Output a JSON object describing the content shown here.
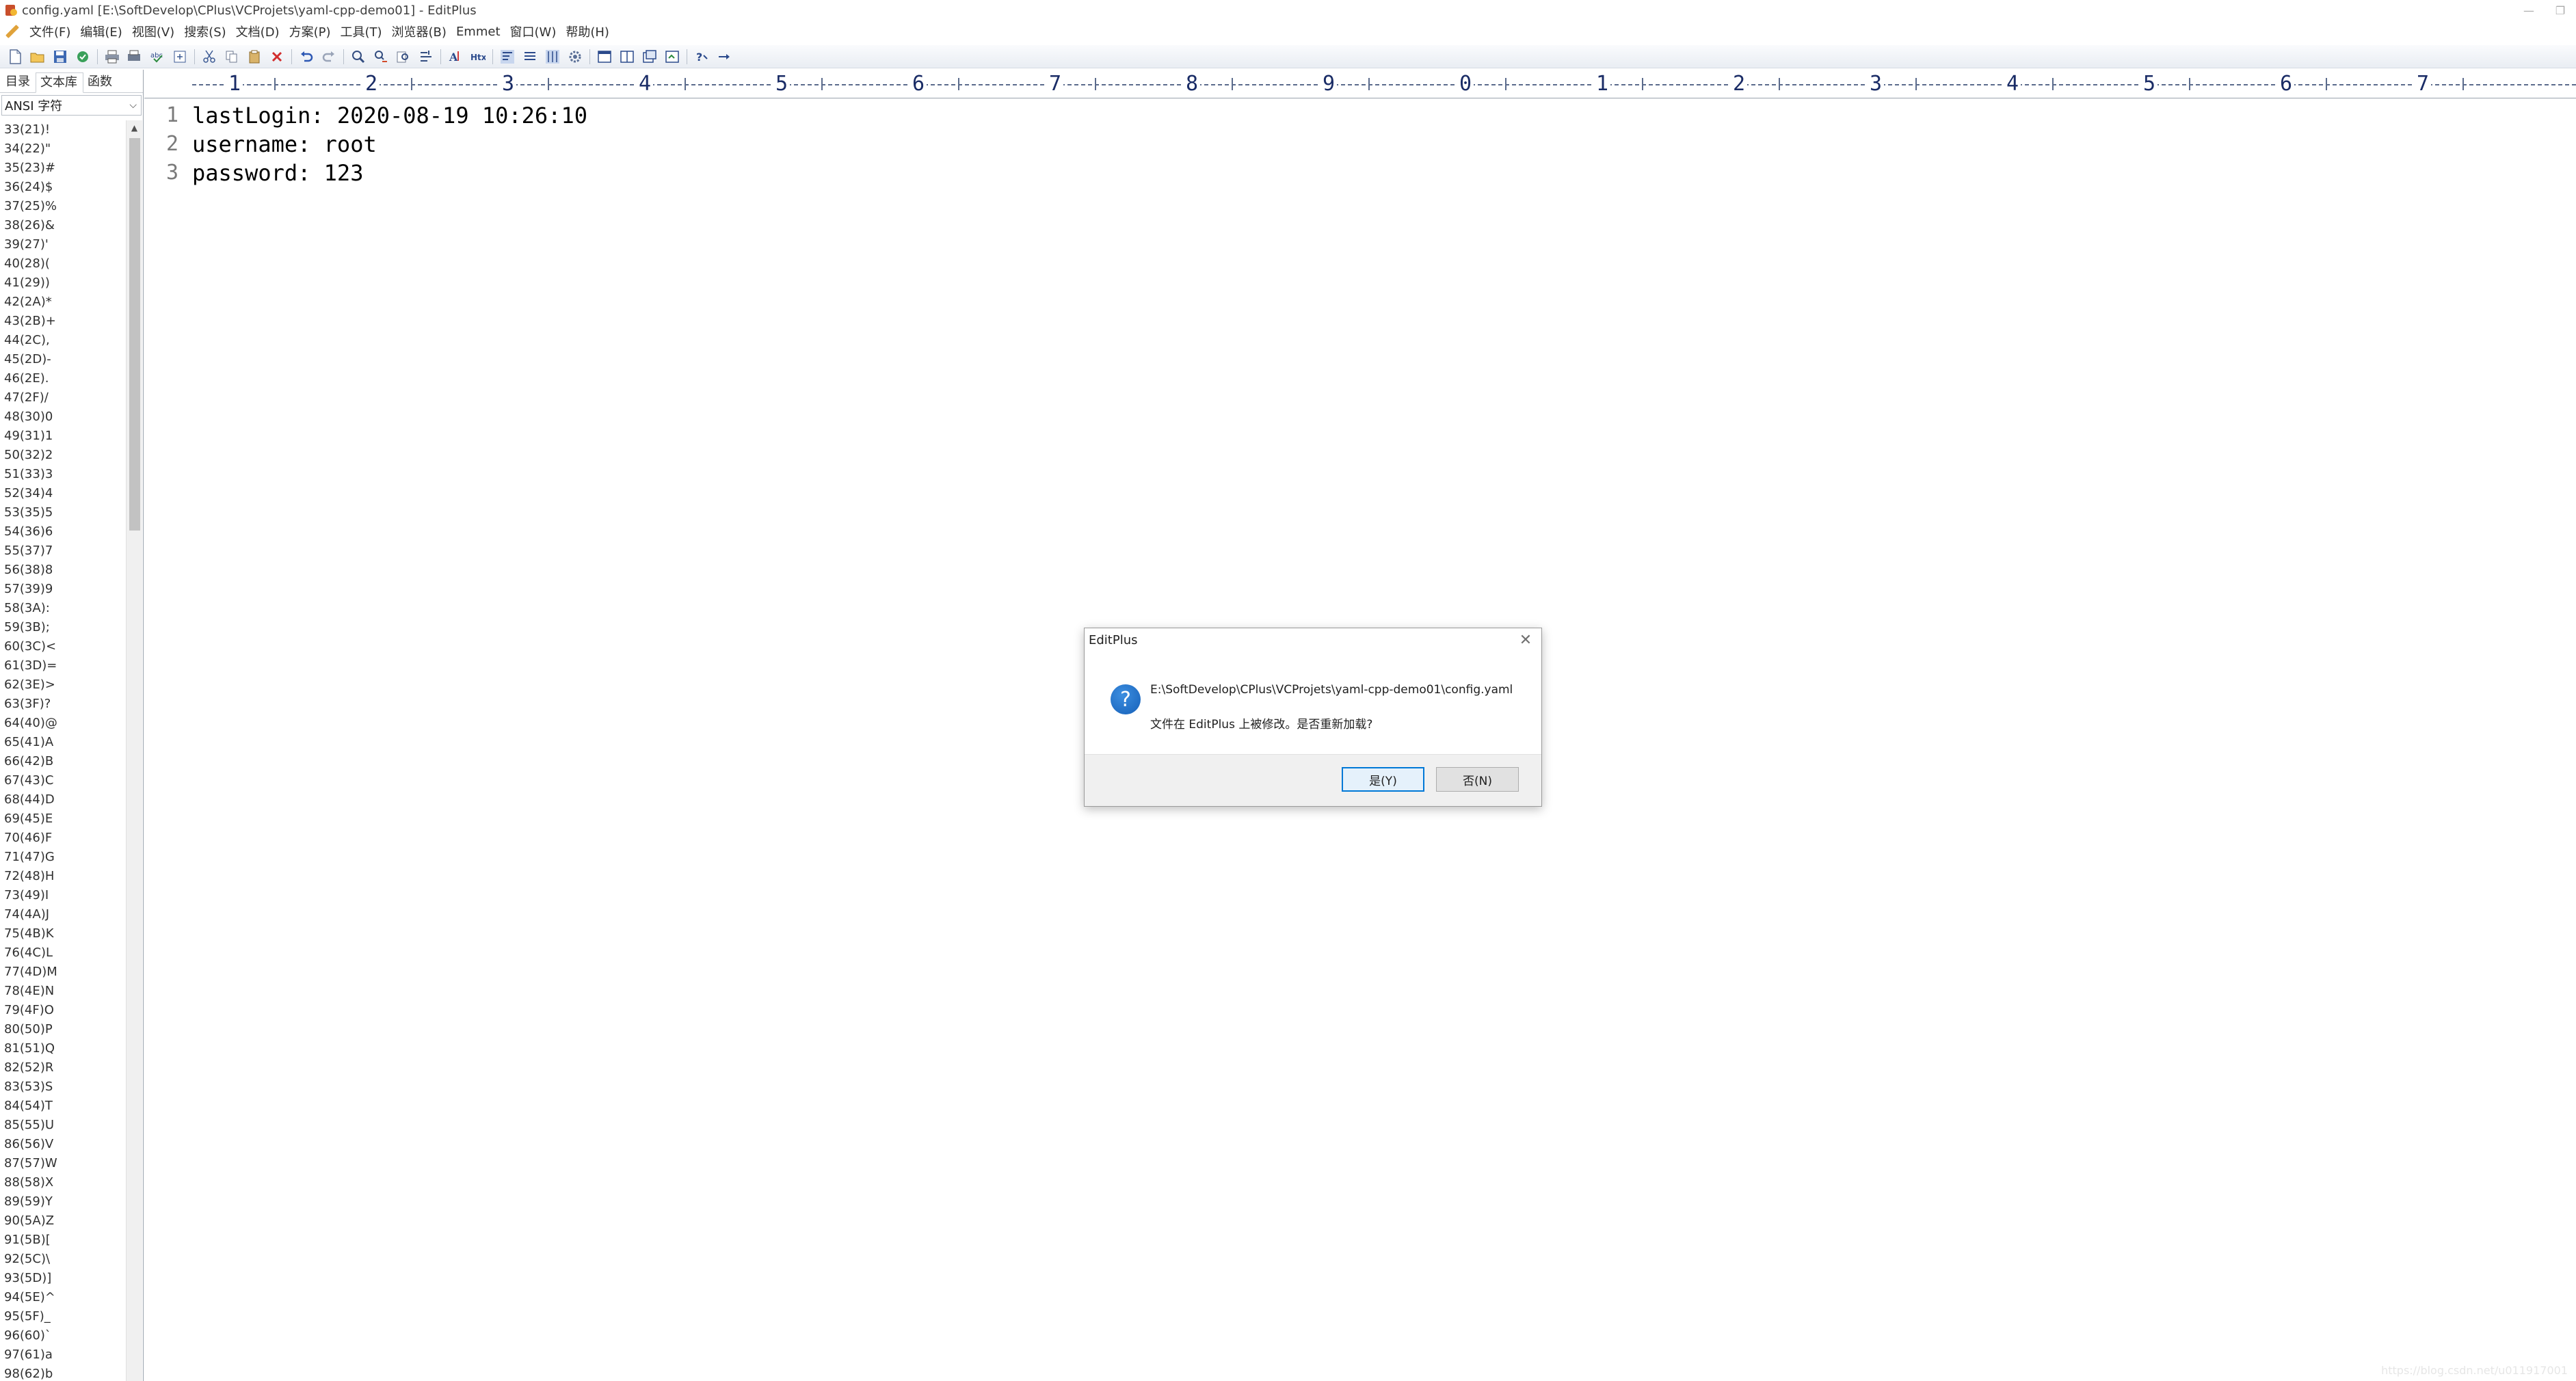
{
  "window": {
    "title": "config.yaml [E:\\SoftDevelop\\CPlus\\VCProjets\\yaml-cpp-demo01] - EditPlus"
  },
  "menu": [
    "文件(F)",
    "编辑(E)",
    "视图(V)",
    "搜索(S)",
    "文档(D)",
    "方案(P)",
    "工具(T)",
    "浏览器(B)",
    "Emmet",
    "窗口(W)",
    "帮助(H)"
  ],
  "toolbar": {
    "buttons": [
      "new-file-icon",
      "open-folder-icon",
      "save-icon",
      "save-all-icon",
      "print-icon",
      "print-preview-icon",
      "spell-check-icon",
      "preview-icon",
      "cut-icon",
      "copy-icon",
      "paste-icon",
      "delete-icon",
      "undo-icon",
      "redo-icon",
      "find-icon",
      "replace-icon",
      "find-in-files-icon",
      "goto-icon",
      "font-icon",
      "html-icon",
      "word-wrap-icon",
      "line-number-icon",
      "ruler-icon",
      "settings-icon",
      "browser-icon",
      "split-icon",
      "window-icon",
      "sync-icon",
      "help-icon",
      "cliptext-icon"
    ]
  },
  "sidebar": {
    "tabs": [
      "目录",
      "文本库",
      "函数"
    ],
    "active_tab": "文本库",
    "select_value": "ANSI 字符",
    "items": [
      "33(21)!",
      "34(22)\"",
      "35(23)#",
      "36(24)$",
      "37(25)%",
      "38(26)&",
      "39(27)'",
      "40(28)(",
      "41(29))",
      "42(2A)*",
      "43(2B)+",
      "44(2C),",
      "45(2D)-",
      "46(2E).",
      "47(2F)/",
      "48(30)0",
      "49(31)1",
      "50(32)2",
      "51(33)3",
      "52(34)4",
      "53(35)5",
      "54(36)6",
      "55(37)7",
      "56(38)8",
      "57(39)9",
      "58(3A):",
      "59(3B);",
      "60(3C)<",
      "61(3D)=",
      "62(3E)>",
      "63(3F)?",
      "64(40)@",
      "65(41)A",
      "66(42)B",
      "67(43)C",
      "68(44)D",
      "69(45)E",
      "70(46)F",
      "71(47)G",
      "72(48)H",
      "73(49)I",
      "74(4A)J",
      "75(4B)K",
      "76(4C)L",
      "77(4D)M",
      "78(4E)N",
      "79(4F)O",
      "80(50)P",
      "81(51)Q",
      "82(52)R",
      "83(53)S",
      "84(54)T",
      "85(55)U",
      "86(56)V",
      "87(57)W",
      "88(58)X",
      "89(59)Y",
      "90(5A)Z",
      "91(5B)[",
      "92(5C)\\",
      "93(5D)]",
      "94(5E)^",
      "95(5F)_",
      "96(60)`",
      "97(61)a",
      "98(62)b"
    ]
  },
  "ruler": {
    "labels": [
      "1",
      "2",
      "3",
      "4",
      "5",
      "6",
      "7",
      "8",
      "9",
      "0",
      "1",
      "2",
      "3",
      "4",
      "5",
      "6",
      "7"
    ]
  },
  "editor": {
    "line_numbers": [
      "1",
      "2",
      "3"
    ],
    "lines": [
      "lastLogin: 2020-08-19 10:26:10",
      "username: root",
      "password: 123"
    ]
  },
  "dialog": {
    "title": "EditPlus",
    "close": "✕",
    "icon": "question-icon",
    "path": "E:\\SoftDevelop\\CPlus\\VCProjets\\yaml-cpp-demo01\\config.yaml",
    "message": "文件在 EditPlus 上被修改。是否重新加载?",
    "yes_label": "是(Y)",
    "no_label": "否(N)"
  },
  "watermark": "https://blog.csdn.net/u011917001"
}
